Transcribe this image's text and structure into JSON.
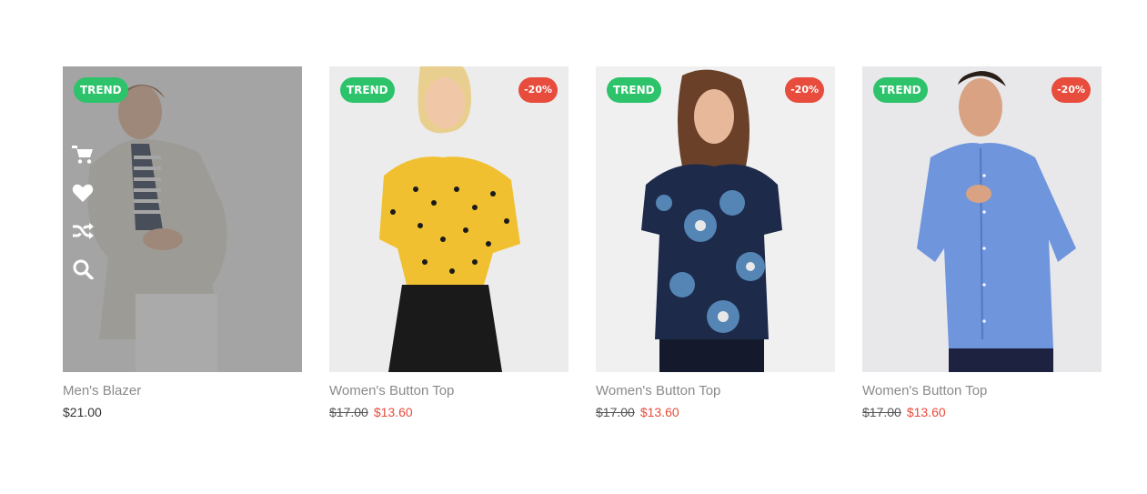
{
  "products": [
    {
      "name": "Men's Blazer",
      "price": "$21.00",
      "badge_trend": "TREND",
      "colors": {
        "background": "#e6e6e6",
        "garment": "#d6d2c8",
        "inner": "#1e2a44"
      }
    },
    {
      "name": "Women's Button Top",
      "old_price": "$17.00",
      "price": "$13.60",
      "badge_trend": "TREND",
      "badge_sale": "-20%",
      "colors": {
        "background": "#ececec",
        "garment": "#f0c030",
        "inner": "#1a1a1a"
      }
    },
    {
      "name": "Women's Button Top",
      "old_price": "$17.00",
      "price": "$13.60",
      "badge_trend": "TREND",
      "badge_sale": "-20%",
      "colors": {
        "background": "#f0f0f0",
        "garment": "#1d2a4a",
        "inner": "#5a8fc0"
      }
    },
    {
      "name": "Women's Button Top",
      "old_price": "$17.00",
      "price": "$13.60",
      "badge_trend": "TREND",
      "badge_sale": "-20%",
      "colors": {
        "background": "#e8e8ea",
        "garment": "#6f95dd",
        "inner": "#1c2240"
      }
    }
  ],
  "hover_actions": [
    "cart-icon",
    "heart-icon",
    "shuffle-icon",
    "search-icon"
  ],
  "accent": {
    "trend": "#2cc36b",
    "sale": "#e74c3c"
  }
}
